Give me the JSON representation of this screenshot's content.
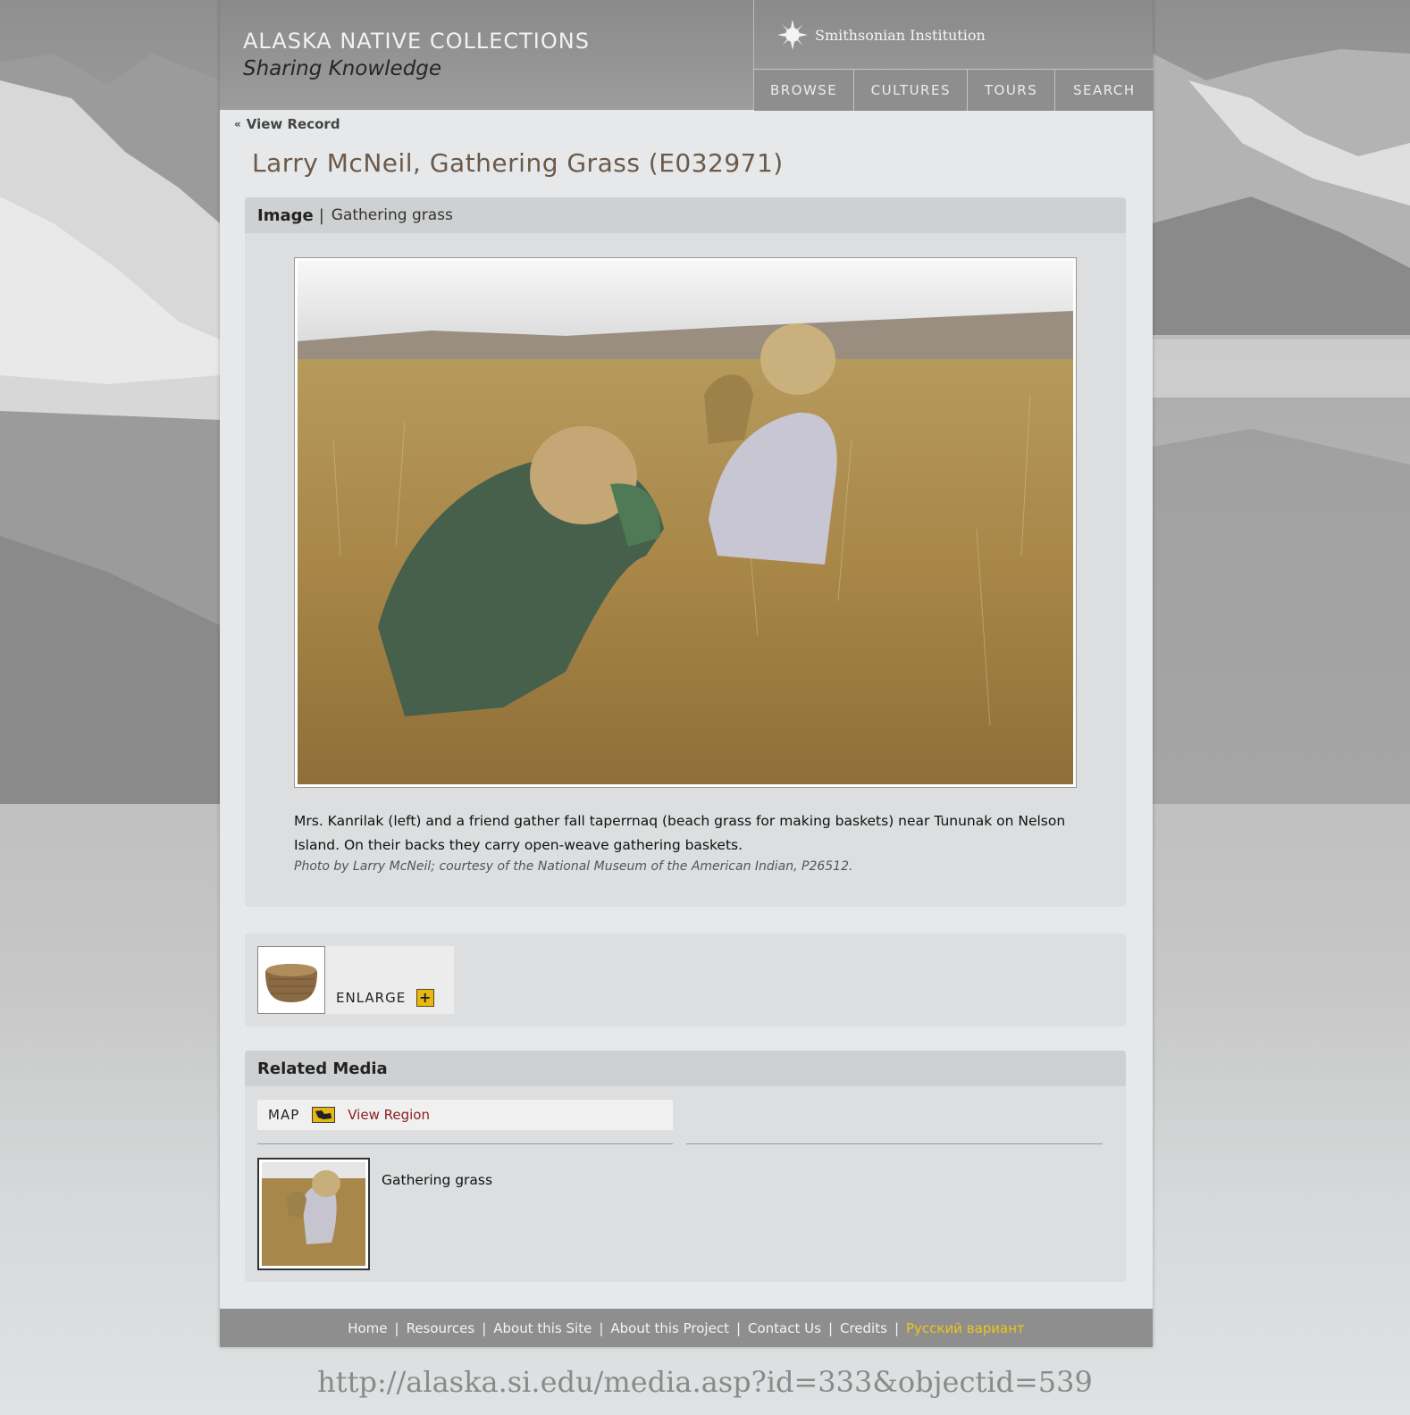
{
  "header": {
    "site_title": "ALASKA NATIVE COLLECTIONS",
    "site_subtitle": "Sharing Knowledge",
    "institution": "Smithsonian Institution",
    "nav": [
      "BROWSE",
      "CULTURES",
      "TOURS",
      "SEARCH"
    ]
  },
  "back_link": "View Record",
  "page_title": "Larry McNeil, Gathering Grass (E032971)",
  "image_panel": {
    "heading": "Image",
    "separator": "|",
    "subheading": "Gathering grass",
    "caption": "Mrs. Kanrilak (left) and a friend gather fall taperrnaq (beach grass for making baskets) near Tununak on Nelson Island. On their backs they carry open-weave gathering baskets.",
    "credit": "Photo by Larry McNeil; courtesy of the National Museum of the American Indian, P26512."
  },
  "object_panel": {
    "enlarge_label": "ENLARGE",
    "enlarge_icon": "plus-icon"
  },
  "related_media": {
    "heading": "Related Media",
    "map_label": "MAP",
    "map_link": "View Region",
    "items": [
      {
        "title": "Gathering grass"
      }
    ]
  },
  "footer": {
    "links": [
      "Home",
      "Resources",
      "About this Site",
      "About this Project",
      "Contact Us",
      "Credits"
    ],
    "russian": "Русский вариант"
  },
  "url_caption": "http://alaska.si.edu/media.asp?id=333&objectid=539",
  "colors": {
    "title_brown": "#6b5a4a",
    "link_red": "#8a1f1f",
    "accent_yellow": "#e7b713",
    "russian_link": "#f0c419"
  }
}
